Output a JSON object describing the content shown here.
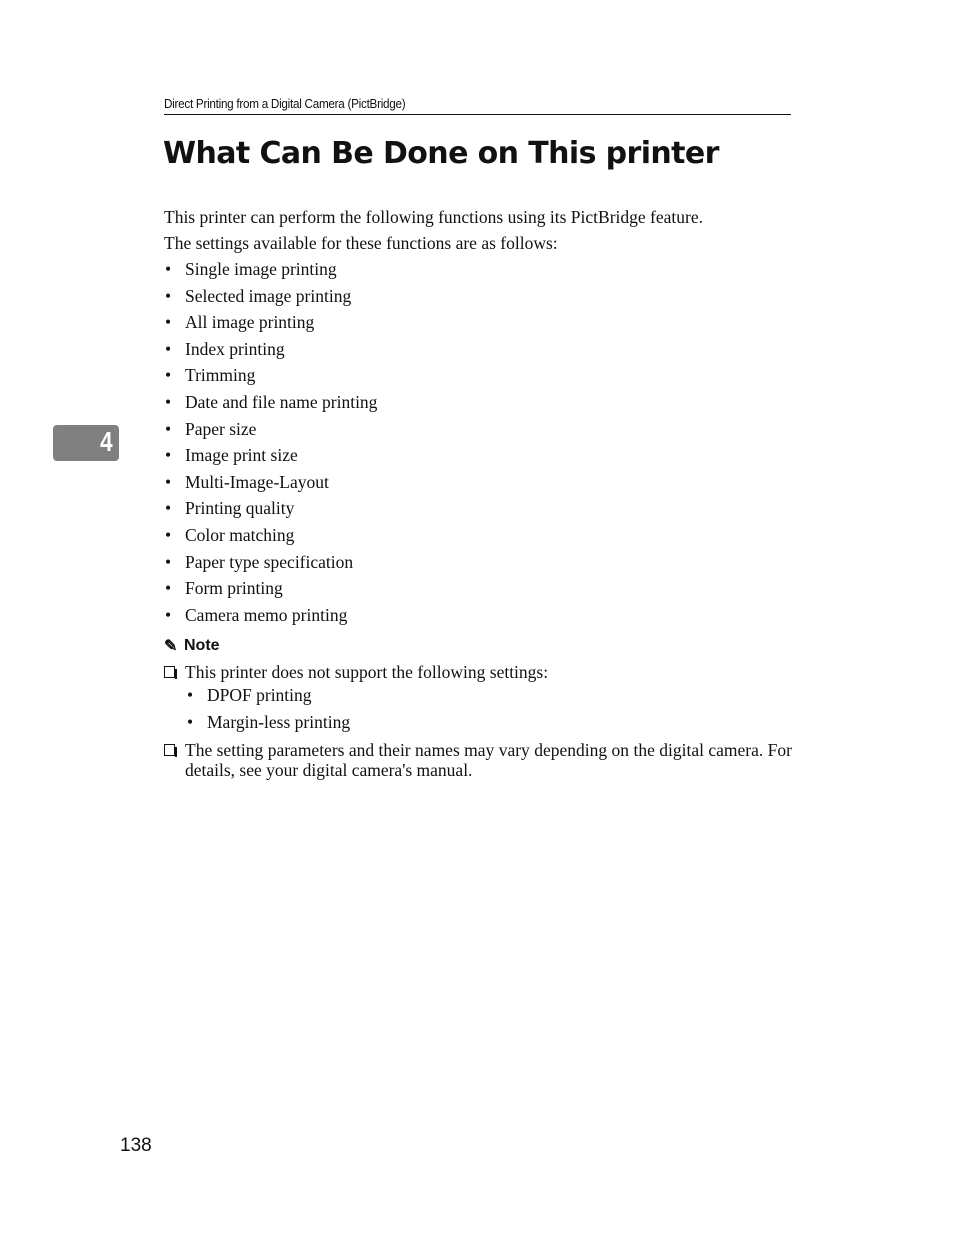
{
  "header": {
    "running_title": "Direct Printing from a Digital Camera (PictBridge)"
  },
  "title": "What Can Be Done on This printer",
  "intro": [
    "This printer can perform the following functions using its PictBridge feature.",
    "The settings available for these functions are as follows:"
  ],
  "functions": [
    "Single image printing",
    "Selected image printing",
    "All image printing",
    "Index printing",
    "Trimming",
    "Date and file name printing",
    "Paper size",
    "Image print size",
    "Multi-Image-Layout",
    "Printing quality",
    "Color matching",
    "Paper type specification",
    "Form printing",
    "Camera memo printing"
  ],
  "bullet_glyph": "•",
  "note": {
    "icon": "pencil-icon",
    "heading": "Note",
    "items": [
      {
        "text": "This printer does not support the following settings:",
        "subitems": [
          "DPOF printing",
          "Margin-less printing"
        ]
      },
      {
        "text": "The setting parameters and their names may vary depending on the digital camera. For details, see your digital camera's manual."
      }
    ]
  },
  "chapter_tab": "4",
  "page_number": "138"
}
